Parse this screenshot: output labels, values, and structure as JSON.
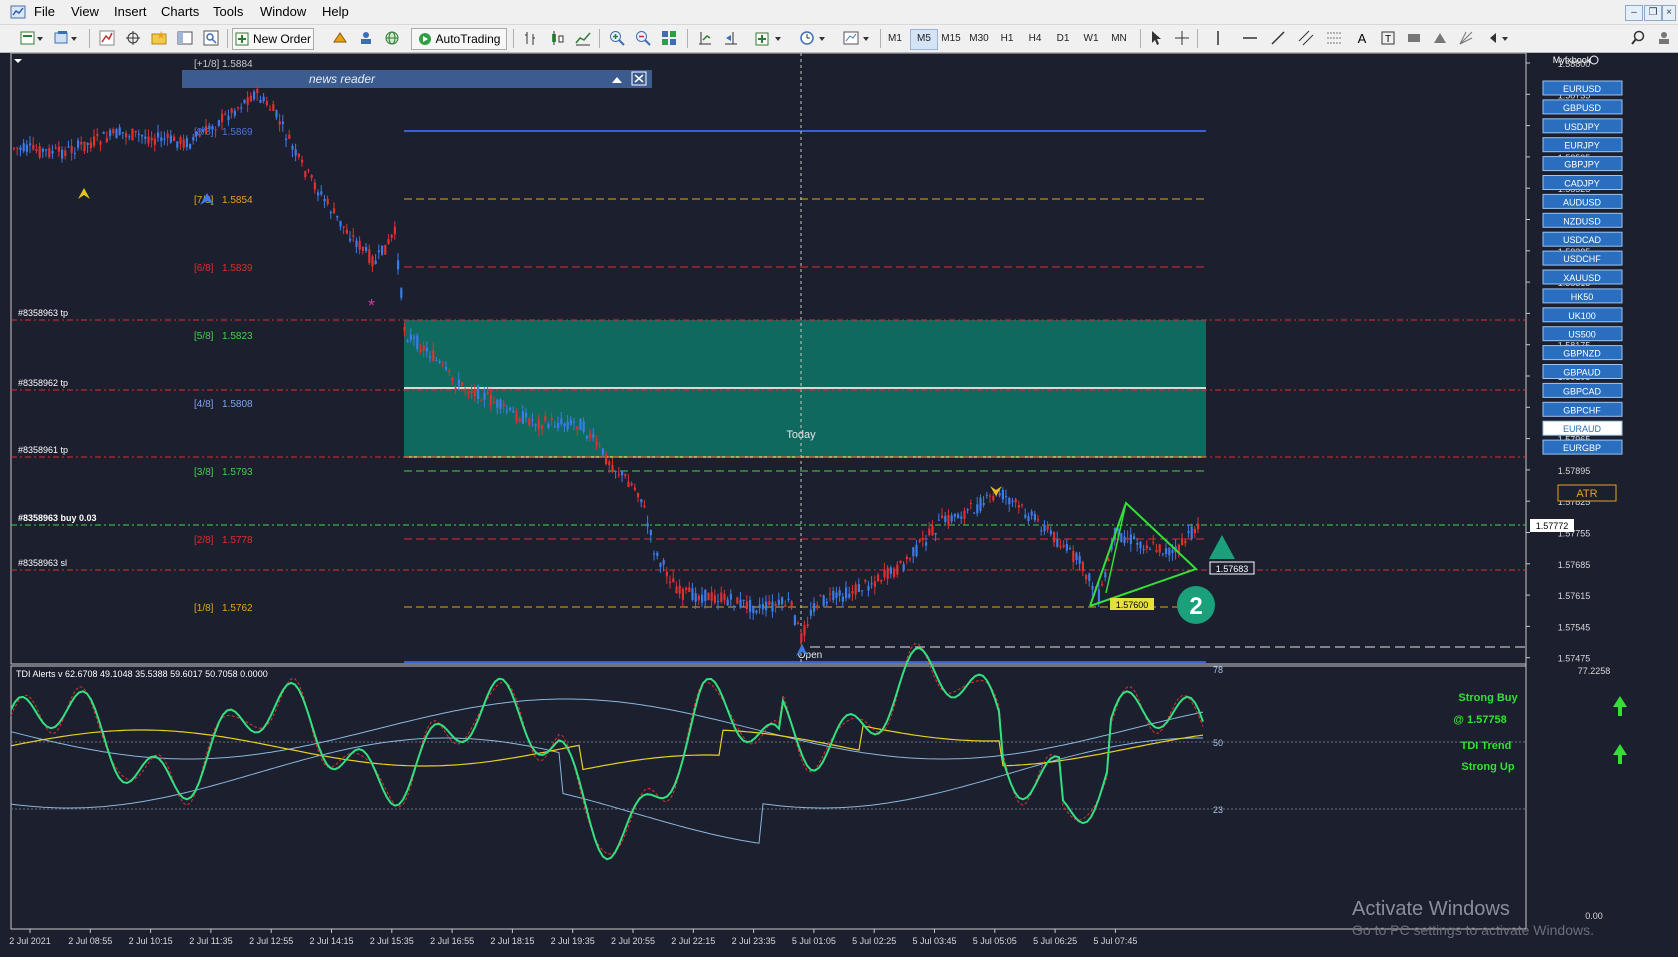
{
  "menu": {
    "items": [
      "File",
      "View",
      "Insert",
      "Charts",
      "Tools",
      "Window",
      "Help"
    ]
  },
  "toolbar": {
    "new_order_label": "New Order",
    "autotrading_label": "AutoTrading",
    "timeframes": [
      "M1",
      "M5",
      "M15",
      "M30",
      "H1",
      "H4",
      "D1",
      "W1",
      "MN"
    ],
    "active_timeframe": "M5"
  },
  "chart": {
    "myfxbook_label": "Myfxbook",
    "news_reader_label": "news reader",
    "today_label": "Today",
    "open_label": "Open",
    "last_price": "1.57772",
    "price_ticks": [
      "1.58800",
      "1.58735",
      "1.58665",
      "1.58595",
      "1.58525",
      "1.58455",
      "1.58385",
      "1.58315",
      "1.58245",
      "1.58175",
      "1.58105",
      "1.58035",
      "1.57965",
      "1.57895",
      "1.57825",
      "1.57755",
      "1.57685",
      "1.57615",
      "1.57545",
      "1.57475"
    ],
    "time_ticks": [
      "2 Jul 2021",
      "2 Jul 08:55",
      "2 Jul 10:15",
      "2 Jul 11:35",
      "2 Jul 12:55",
      "2 Jul 14:15",
      "2 Jul 15:35",
      "2 Jul 16:55",
      "2 Jul 18:15",
      "2 Jul 19:35",
      "2 Jul 20:55",
      "2 Jul 22:15",
      "2 Jul 23:35",
      "5 Jul 01:05",
      "5 Jul 02:25",
      "5 Jul 03:45",
      "5 Jul 05:05",
      "5 Jul 06:25",
      "5 Jul 07:45"
    ],
    "murrey_levels": [
      {
        "label": "[+1/8]",
        "value": "1.5884",
        "color": "#c8c8c8"
      },
      {
        "label": "[8/8]",
        "value": "1.5869",
        "color": "#4f73d8"
      },
      {
        "label": "[7/8]",
        "value": "1.5854",
        "color": "#e6a21c"
      },
      {
        "label": "[6/8]",
        "value": "1.5839",
        "color": "#e02c2c"
      },
      {
        "label": "[5/8]",
        "value": "1.5823",
        "color": "#44d04a"
      },
      {
        "label": "[4/8]",
        "value": "1.5808",
        "color": "#7fa4e8"
      },
      {
        "label": "[3/8]",
        "value": "1.5793",
        "color": "#44d04a"
      },
      {
        "label": "[2/8]",
        "value": "1.5778",
        "color": "#e02c2c"
      },
      {
        "label": "[1/8]",
        "value": "1.5762",
        "color": "#e6a21c"
      }
    ],
    "orders": [
      {
        "label": "#8358963 tp"
      },
      {
        "label": "#8358962 tp"
      },
      {
        "label": "#8358961 tp"
      },
      {
        "label": "#8358963 buy 0.03"
      },
      {
        "label": "#8358963 sl"
      }
    ],
    "pattern_price_high": "1.57683",
    "pattern_price_low": "1.57600",
    "pattern_number": "2",
    "symbols": [
      "EURUSD",
      "GBPUSD",
      "USDJPY",
      "EURJPY",
      "GBPJPY",
      "CADJPY",
      "AUDUSD",
      "NZDUSD",
      "USDCAD",
      "USDCHF",
      "XAUUSD",
      "HK50",
      "UK100",
      "US500",
      "GBPNZD",
      "GBPAUD",
      "GBPCAD",
      "GBPCHF",
      "EURAUD",
      "EURGBP"
    ],
    "active_symbol": "EURAUD",
    "atr_label": "ATR",
    "colors": {
      "background": "#1b1f2e",
      "bull": "#3d7be6",
      "bear": "#e03030",
      "zone": "#0f6e62"
    }
  },
  "indicator": {
    "title": "TDI Alerts v 62.6708 49.1048 35.5388 59.6017 50.7058 0.0000",
    "levels": [
      "78",
      "50",
      "23"
    ],
    "right_ticks": [
      "77.2258",
      "0.00"
    ],
    "signal_line1": "Strong Buy",
    "signal_line2": "@ 1.57758",
    "trend_line1": "TDI Trend",
    "trend_line2": "Strong Up"
  },
  "watermark": {
    "line1": "Activate Windows",
    "line2": "Go to PC settings to activate Windows."
  }
}
